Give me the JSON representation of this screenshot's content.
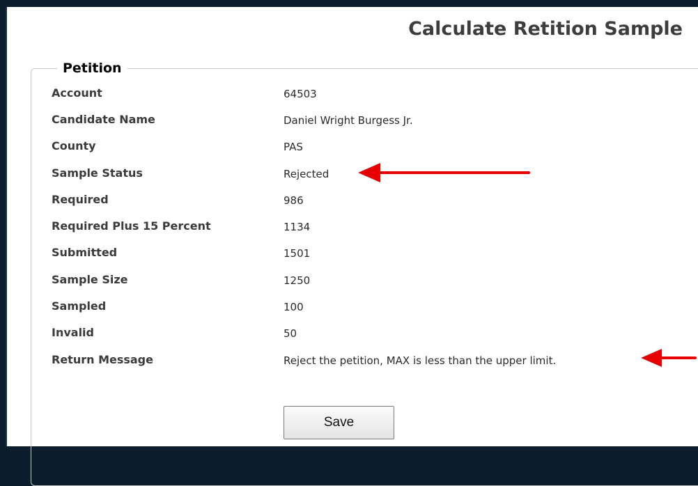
{
  "page_title": "Calculate Retition Sample",
  "section": {
    "legend": "Petition",
    "rows": [
      {
        "label": "Account",
        "value": "64503"
      },
      {
        "label": "Candidate Name",
        "value": "Daniel Wright Burgess Jr."
      },
      {
        "label": "County",
        "value": "PAS"
      },
      {
        "label": "Sample Status",
        "value": "Rejected"
      },
      {
        "label": "Required",
        "value": "986"
      },
      {
        "label": "Required Plus 15 Percent",
        "value": "1134"
      },
      {
        "label": "Submitted",
        "value": "1501"
      },
      {
        "label": "Sample Size",
        "value": "1250"
      },
      {
        "label": "Sampled",
        "value": "100"
      },
      {
        "label": "Invalid",
        "value": "50"
      },
      {
        "label": "Return Message",
        "value": "Reject the petition, MAX is less than the upper limit."
      }
    ]
  },
  "actions": {
    "save_label": "Save"
  },
  "annotations": {
    "arrow_color": "#e60000",
    "arrow_icons": [
      "left-arrow-icon",
      "left-arrow-icon"
    ]
  },
  "colors": {
    "frame": "#0b1d2c",
    "panel": "#ffffff",
    "label_text": "#3a3a3a",
    "value_text": "#2a2a2a"
  }
}
